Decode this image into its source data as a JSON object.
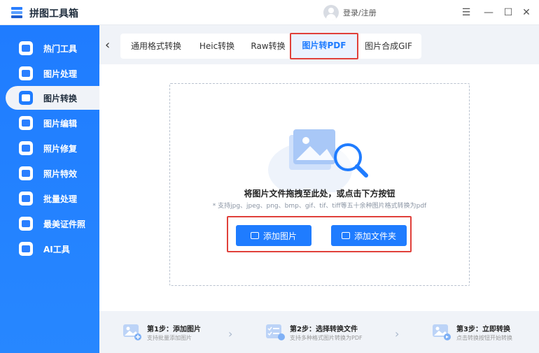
{
  "app": {
    "title": "拼图工具箱",
    "login_text": "登录/注册"
  },
  "window_controls": {
    "menu": "☰",
    "minimize": "—",
    "maximize": "☐",
    "close": "✕"
  },
  "sidebar": {
    "items": [
      {
        "label": "热门工具",
        "icon": "hot-tools-icon"
      },
      {
        "label": "图片处理",
        "icon": "image-process-icon"
      },
      {
        "label": "图片转换",
        "icon": "image-convert-icon",
        "active": true
      },
      {
        "label": "图片编辑",
        "icon": "image-edit-icon"
      },
      {
        "label": "照片修复",
        "icon": "photo-repair-icon"
      },
      {
        "label": "照片特效",
        "icon": "photo-effect-icon"
      },
      {
        "label": "批量处理",
        "icon": "batch-process-icon"
      },
      {
        "label": "最美证件照",
        "icon": "id-photo-icon"
      },
      {
        "label": "AI工具",
        "icon": "ai-tools-icon"
      }
    ]
  },
  "tabs": [
    {
      "label": "通用格式转换"
    },
    {
      "label": "Heic转换"
    },
    {
      "label": "Raw转换"
    },
    {
      "label": "图片转PDF",
      "active": true
    },
    {
      "label": "图片合成GIF"
    }
  ],
  "dropzone": {
    "title": "将图片文件拖拽至此处，或点击下方按钮",
    "subtitle": "* 支持jpg、jpeg、png、bmp、gif、tif、tiff等五十余种图片格式转换为pdf",
    "add_image_label": "添加图片",
    "add_folder_label": "添加文件夹"
  },
  "steps": [
    {
      "title": "第1步：添加图片",
      "desc": "支持批量添加图片"
    },
    {
      "title": "第2步：选择转换文件",
      "desc": "支持多种格式图片转换为PDF"
    },
    {
      "title": "第3步：立即转换",
      "desc": "点击转换按钮开始转换"
    }
  ],
  "colors": {
    "primary": "#1f7cff",
    "highlight_border": "#e0403a",
    "background": "#f0f3f8"
  }
}
